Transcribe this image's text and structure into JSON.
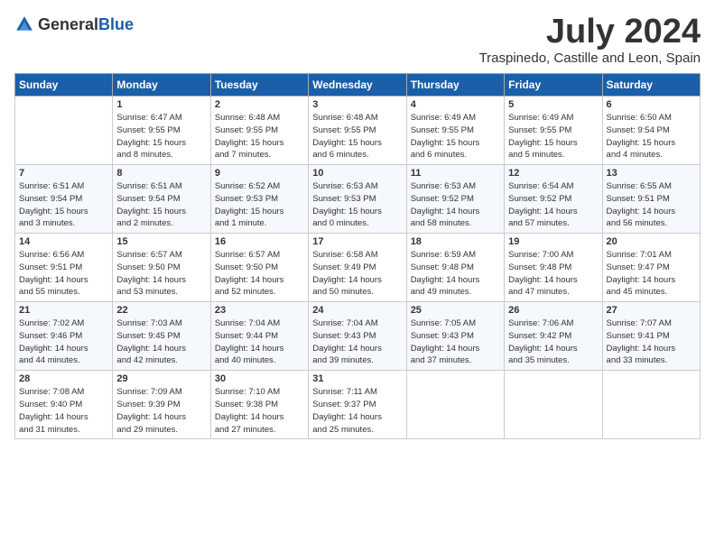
{
  "logo": {
    "general": "General",
    "blue": "Blue"
  },
  "header": {
    "month": "July 2024",
    "location": "Traspinedo, Castille and Leon, Spain"
  },
  "weekdays": [
    "Sunday",
    "Monday",
    "Tuesday",
    "Wednesday",
    "Thursday",
    "Friday",
    "Saturday"
  ],
  "weeks": [
    [
      {
        "day": "",
        "info": ""
      },
      {
        "day": "1",
        "info": "Sunrise: 6:47 AM\nSunset: 9:55 PM\nDaylight: 15 hours\nand 8 minutes."
      },
      {
        "day": "2",
        "info": "Sunrise: 6:48 AM\nSunset: 9:55 PM\nDaylight: 15 hours\nand 7 minutes."
      },
      {
        "day": "3",
        "info": "Sunrise: 6:48 AM\nSunset: 9:55 PM\nDaylight: 15 hours\nand 6 minutes."
      },
      {
        "day": "4",
        "info": "Sunrise: 6:49 AM\nSunset: 9:55 PM\nDaylight: 15 hours\nand 6 minutes."
      },
      {
        "day": "5",
        "info": "Sunrise: 6:49 AM\nSunset: 9:55 PM\nDaylight: 15 hours\nand 5 minutes."
      },
      {
        "day": "6",
        "info": "Sunrise: 6:50 AM\nSunset: 9:54 PM\nDaylight: 15 hours\nand 4 minutes."
      }
    ],
    [
      {
        "day": "7",
        "info": "Sunrise: 6:51 AM\nSunset: 9:54 PM\nDaylight: 15 hours\nand 3 minutes."
      },
      {
        "day": "8",
        "info": "Sunrise: 6:51 AM\nSunset: 9:54 PM\nDaylight: 15 hours\nand 2 minutes."
      },
      {
        "day": "9",
        "info": "Sunrise: 6:52 AM\nSunset: 9:53 PM\nDaylight: 15 hours\nand 1 minute."
      },
      {
        "day": "10",
        "info": "Sunrise: 6:53 AM\nSunset: 9:53 PM\nDaylight: 15 hours\nand 0 minutes."
      },
      {
        "day": "11",
        "info": "Sunrise: 6:53 AM\nSunset: 9:52 PM\nDaylight: 14 hours\nand 58 minutes."
      },
      {
        "day": "12",
        "info": "Sunrise: 6:54 AM\nSunset: 9:52 PM\nDaylight: 14 hours\nand 57 minutes."
      },
      {
        "day": "13",
        "info": "Sunrise: 6:55 AM\nSunset: 9:51 PM\nDaylight: 14 hours\nand 56 minutes."
      }
    ],
    [
      {
        "day": "14",
        "info": "Sunrise: 6:56 AM\nSunset: 9:51 PM\nDaylight: 14 hours\nand 55 minutes."
      },
      {
        "day": "15",
        "info": "Sunrise: 6:57 AM\nSunset: 9:50 PM\nDaylight: 14 hours\nand 53 minutes."
      },
      {
        "day": "16",
        "info": "Sunrise: 6:57 AM\nSunset: 9:50 PM\nDaylight: 14 hours\nand 52 minutes."
      },
      {
        "day": "17",
        "info": "Sunrise: 6:58 AM\nSunset: 9:49 PM\nDaylight: 14 hours\nand 50 minutes."
      },
      {
        "day": "18",
        "info": "Sunrise: 6:59 AM\nSunset: 9:48 PM\nDaylight: 14 hours\nand 49 minutes."
      },
      {
        "day": "19",
        "info": "Sunrise: 7:00 AM\nSunset: 9:48 PM\nDaylight: 14 hours\nand 47 minutes."
      },
      {
        "day": "20",
        "info": "Sunrise: 7:01 AM\nSunset: 9:47 PM\nDaylight: 14 hours\nand 45 minutes."
      }
    ],
    [
      {
        "day": "21",
        "info": "Sunrise: 7:02 AM\nSunset: 9:46 PM\nDaylight: 14 hours\nand 44 minutes."
      },
      {
        "day": "22",
        "info": "Sunrise: 7:03 AM\nSunset: 9:45 PM\nDaylight: 14 hours\nand 42 minutes."
      },
      {
        "day": "23",
        "info": "Sunrise: 7:04 AM\nSunset: 9:44 PM\nDaylight: 14 hours\nand 40 minutes."
      },
      {
        "day": "24",
        "info": "Sunrise: 7:04 AM\nSunset: 9:43 PM\nDaylight: 14 hours\nand 39 minutes."
      },
      {
        "day": "25",
        "info": "Sunrise: 7:05 AM\nSunset: 9:43 PM\nDaylight: 14 hours\nand 37 minutes."
      },
      {
        "day": "26",
        "info": "Sunrise: 7:06 AM\nSunset: 9:42 PM\nDaylight: 14 hours\nand 35 minutes."
      },
      {
        "day": "27",
        "info": "Sunrise: 7:07 AM\nSunset: 9:41 PM\nDaylight: 14 hours\nand 33 minutes."
      }
    ],
    [
      {
        "day": "28",
        "info": "Sunrise: 7:08 AM\nSunset: 9:40 PM\nDaylight: 14 hours\nand 31 minutes."
      },
      {
        "day": "29",
        "info": "Sunrise: 7:09 AM\nSunset: 9:39 PM\nDaylight: 14 hours\nand 29 minutes."
      },
      {
        "day": "30",
        "info": "Sunrise: 7:10 AM\nSunset: 9:38 PM\nDaylight: 14 hours\nand 27 minutes."
      },
      {
        "day": "31",
        "info": "Sunrise: 7:11 AM\nSunset: 9:37 PM\nDaylight: 14 hours\nand 25 minutes."
      },
      {
        "day": "",
        "info": ""
      },
      {
        "day": "",
        "info": ""
      },
      {
        "day": "",
        "info": ""
      }
    ]
  ]
}
